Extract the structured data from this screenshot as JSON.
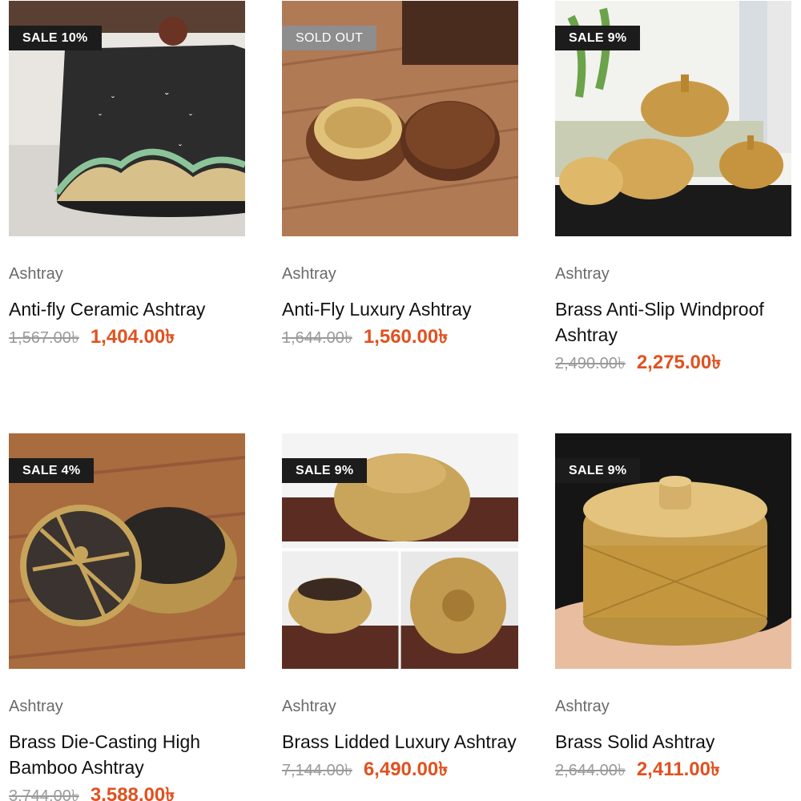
{
  "products": [
    {
      "badge": "SALE 10%",
      "category": "Ashtray",
      "title": "Anti-fly Ceramic Ashtray",
      "old_price": "1,567.00৳",
      "new_price": "1,404.00৳"
    },
    {
      "badge": "SOLD OUT",
      "category": "Ashtray",
      "title": "Anti-Fly Luxury Ashtray",
      "old_price": "1,644.00৳",
      "new_price": "1,560.00৳"
    },
    {
      "badge": "SALE 9%",
      "category": "Ashtray",
      "title": "Brass Anti-Slip Windproof Ashtray",
      "old_price": "2,490.00৳",
      "new_price": "2,275.00৳"
    },
    {
      "badge": "SALE 4%",
      "category": "Ashtray",
      "title": "Brass Die-Casting High Bamboo Ashtray",
      "old_price": "3,744.00৳",
      "new_price": "3,588.00৳"
    },
    {
      "badge": "SALE 9%",
      "category": "Ashtray",
      "title": "Brass Lidded Luxury Ashtray",
      "old_price": "7,144.00৳",
      "new_price": "6,490.00৳"
    },
    {
      "badge": "SALE 9%",
      "category": "Ashtray",
      "title": "Brass Solid Ashtray",
      "old_price": "2,644.00৳",
      "new_price": "2,411.00৳"
    }
  ],
  "colors": {
    "sale_badge": "#1c1c1c",
    "sold_out_badge": "#8e8e8e",
    "sale_price": "#e0511f",
    "old_price": "#9a9a9a"
  }
}
